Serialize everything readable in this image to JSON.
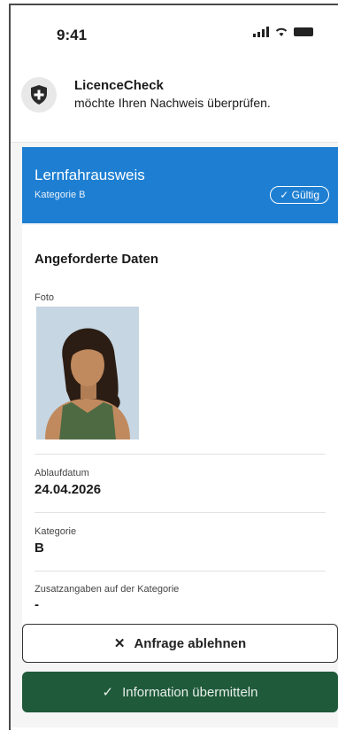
{
  "status_bar": {
    "time": "9:41"
  },
  "requester": {
    "name": "LicenceCheck",
    "message": "möchte Ihren Nachweis überprüfen."
  },
  "credential": {
    "title": "Lernfahrausweis",
    "subtitle": "Kategorie B",
    "status": "Gültig"
  },
  "requested": {
    "heading": "Angeforderte Daten",
    "photo_label": "Foto",
    "fields": [
      {
        "label": "Ablaufdatum",
        "value": "24.04.2026"
      },
      {
        "label": "Kategorie",
        "value": "B"
      },
      {
        "label": "Zusatzangaben auf der Kategorie",
        "value": "-"
      }
    ]
  },
  "actions": {
    "decline_label": "Anfrage ablehnen",
    "submit_label": "Information übermitteln"
  },
  "colors": {
    "card_blue": "#1e7fd2",
    "submit_green": "#1f5a3a"
  }
}
